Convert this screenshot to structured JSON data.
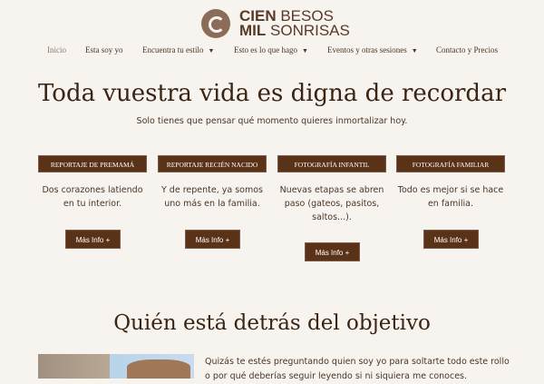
{
  "logo": {
    "line1a": "CIEN",
    "line1b": " BESOS",
    "line2a": "MIL",
    "line2b": " SONRISAS"
  },
  "nav": [
    "Inicio",
    "Esta soy yo",
    "Encuentra tu estilo",
    "Esto es lo que hago",
    "Eventos y otras sesiones",
    "Contacto y Precios"
  ],
  "hero": {
    "title": "Toda vuestra vida es digna de recordar",
    "subtitle": "Solo tienes que pensar qué momento quieres inmortalizar hoy."
  },
  "cards": [
    {
      "title": "REPORTAJE DE PREMAMÁ",
      "text": "Dos corazones latiendo en tu interior.",
      "button": "Más Info +"
    },
    {
      "title": "REPORTAJE RECIÉN NACIDO",
      "text": "Y de repente, ya somos uno más en la familia.",
      "button": "Más Info +"
    },
    {
      "title": "FOTOGRAFÍA INFANTIL",
      "text": "Nuevas etapas se abren paso (gateos, pasitos, saltos...).",
      "button": "Más Info +"
    },
    {
      "title": "FOTOGRAFÍA FAMILIAR",
      "text": "Todo es mejor si se hace en familia.",
      "button": "Más Info +"
    }
  ],
  "about": {
    "title": "Quién está detrás del objetivo",
    "text": "Quizás te estés preguntando quien soy yo para soltarte todo este rollo o por qué deberías seguir leyendo si ni siquiera me conoces."
  }
}
